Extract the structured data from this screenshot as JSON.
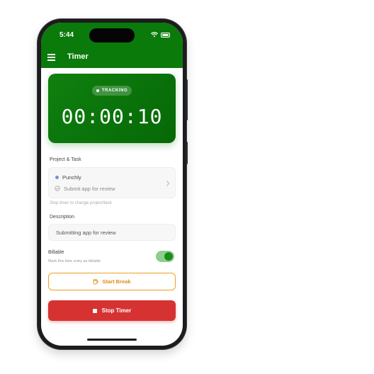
{
  "status_bar": {
    "time": "5:44"
  },
  "header": {
    "title": "Timer"
  },
  "timer_card": {
    "status_label": "TRACKING",
    "elapsed": "00:00:10"
  },
  "project_section": {
    "label": "Project & Task",
    "project_name": "Punchly",
    "task_name": "Submit app for review",
    "hint": "Stop timer to change project/task"
  },
  "description_section": {
    "label": "Description",
    "value": "Submitting app for review"
  },
  "billable": {
    "label": "Billable",
    "subtitle": "Mark this time entry as billable",
    "enabled": true
  },
  "actions": {
    "break_label": "Start Break",
    "stop_label": "Stop Timer"
  },
  "colors": {
    "primary_green": "#0a7a0a",
    "stop_red": "#d63232",
    "break_orange": "#f0a020"
  }
}
